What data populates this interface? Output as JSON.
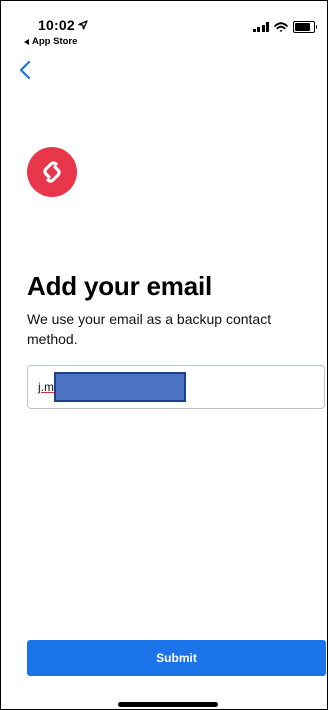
{
  "status_bar": {
    "time": "10:02",
    "back_app_label": "App Store"
  },
  "icons": {
    "back": "chevron-left-icon",
    "logo": "chain-link-icon",
    "location": "location-arrow-icon",
    "signal": "cellular-signal-icon",
    "wifi": "wifi-icon",
    "battery": "battery-icon"
  },
  "colors": {
    "accent": "#1a73e8",
    "logo_bg": "#e8374b",
    "redaction": "#4a73c4"
  },
  "page": {
    "title": "Add your email",
    "subtitle": "We use your email as a backup contact method."
  },
  "email_input": {
    "value": "j.m"
  },
  "submit": {
    "label": "Submit"
  }
}
